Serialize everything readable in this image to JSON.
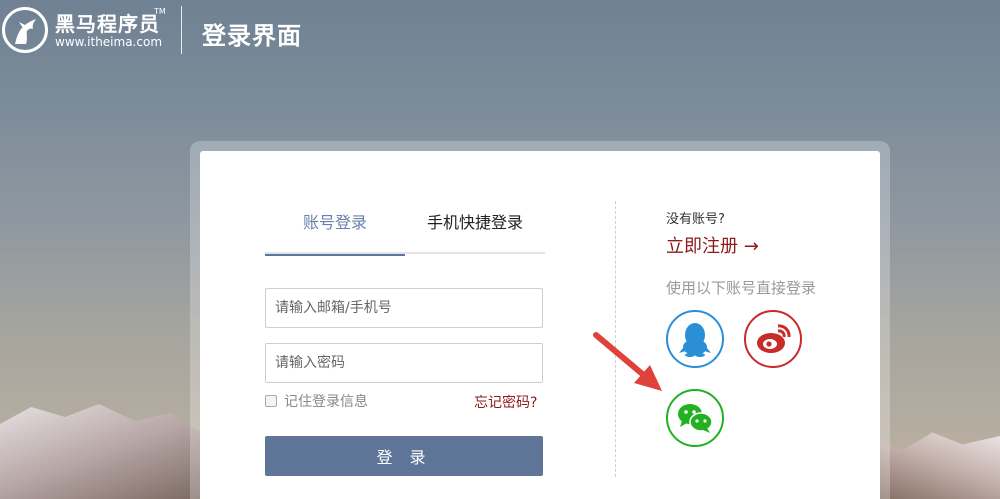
{
  "header": {
    "brand_name": "黑马程序员",
    "brand_tm": "TM",
    "brand_url": "www.itheima.com",
    "page_title": "登录界面"
  },
  "login": {
    "tabs": [
      {
        "label": "账号登录",
        "active": true
      },
      {
        "label": "手机快捷登录",
        "active": false
      }
    ],
    "email_placeholder": "请输入邮箱/手机号",
    "password_placeholder": "请输入密码",
    "remember_label": "记住登录信息",
    "forgot_label": "忘记密码?",
    "login_button": "登 录"
  },
  "register": {
    "no_account": "没有账号?",
    "register_link": "立即注册 →",
    "third_party_label": "使用以下账号直接登录"
  },
  "social": [
    {
      "name": "qq-icon",
      "color": "#2b8fd6"
    },
    {
      "name": "weibo-icon",
      "color": "#c92a2a"
    },
    {
      "name": "wechat-icon",
      "color": "#23b022"
    }
  ],
  "colors": {
    "accent": "#5f7598",
    "link": "#8b1a1a",
    "annotation_arrow": "#e0413a"
  }
}
